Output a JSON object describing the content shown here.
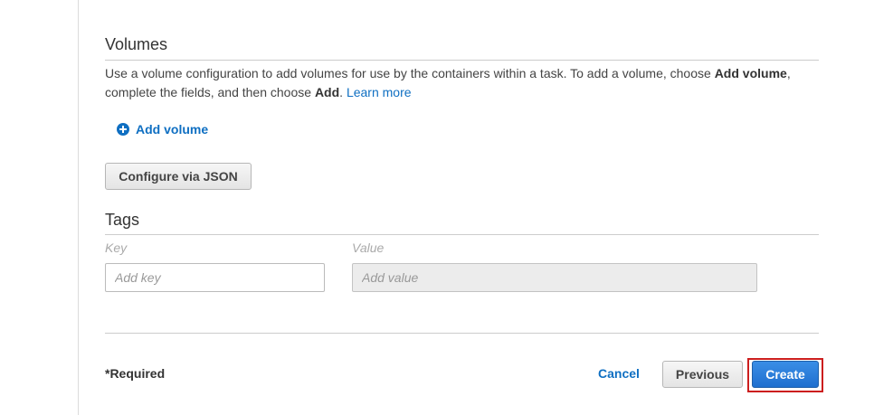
{
  "volumes": {
    "title": "Volumes",
    "desc_prefix": "Use a volume configuration to add volumes for use by the containers within a task. To add a volume, choose ",
    "desc_bold1": "Add volume",
    "desc_mid": ", complete the fields, and then choose ",
    "desc_bold2": "Add",
    "desc_suffix": ". ",
    "learn_more": "Learn more",
    "add_volume_label": "Add volume",
    "configure_json_label": "Configure via JSON"
  },
  "tags": {
    "title": "Tags",
    "key_label": "Key",
    "value_label": "Value",
    "key_placeholder": "Add key",
    "value_placeholder": "Add value"
  },
  "footer": {
    "required_text": "*Required",
    "cancel_label": "Cancel",
    "previous_label": "Previous",
    "create_label": "Create"
  },
  "icons": {
    "add_volume": "plus-circle-icon"
  },
  "colors": {
    "link": "#0f6fc2",
    "primary": "#1f6fcf",
    "highlight": "#cc1e1e"
  }
}
